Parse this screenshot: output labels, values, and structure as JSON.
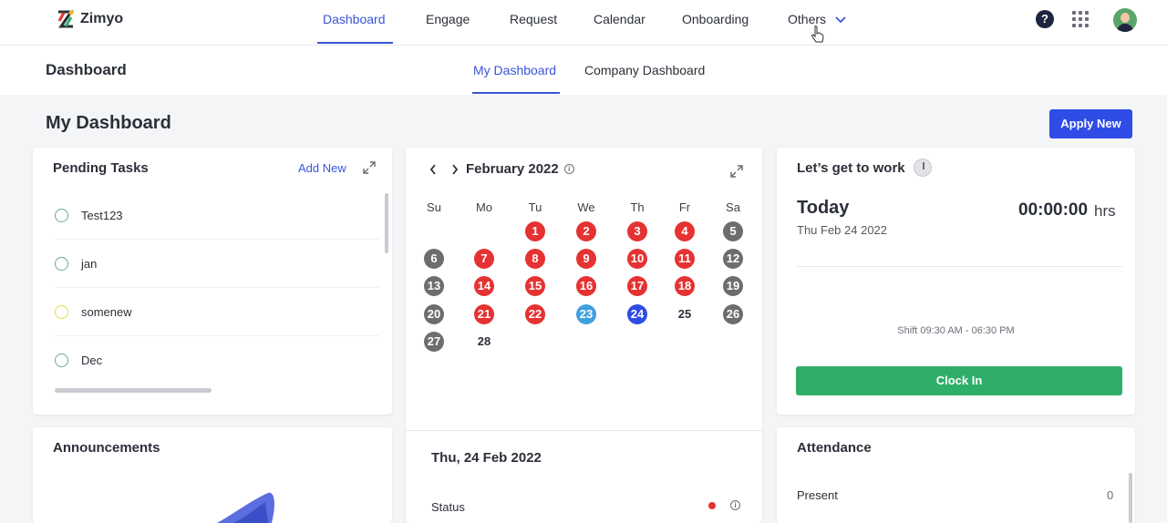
{
  "app": {
    "name": "Zimyo"
  },
  "topnav": {
    "items": [
      "Dashboard",
      "Engage",
      "Request",
      "Calendar",
      "Onboarding",
      "Others"
    ],
    "active": "Dashboard",
    "help_label": "?"
  },
  "subheader": {
    "title": "Dashboard",
    "tabs": [
      "My Dashboard",
      "Company Dashboard"
    ],
    "active_tab": "My Dashboard"
  },
  "page": {
    "title": "My Dashboard",
    "apply_button": "Apply New"
  },
  "pending_tasks": {
    "title": "Pending Tasks",
    "add_new": "Add New",
    "tasks": [
      {
        "label": "Test123",
        "color": "#6da6a0"
      },
      {
        "label": "jan",
        "color": "#6da6a0"
      },
      {
        "label": "somenew",
        "color": "#e6df3c"
      },
      {
        "label": "Dec",
        "color": "#6da6a0"
      }
    ]
  },
  "calendar": {
    "month": "February 2022",
    "info_icon": "i",
    "weekdays": [
      "Su",
      "Mo",
      "Tu",
      "We",
      "Th",
      "Fr",
      "Sa"
    ],
    "days": [
      {
        "d": "1",
        "status": "red"
      },
      {
        "d": "2",
        "status": "red"
      },
      {
        "d": "3",
        "status": "red"
      },
      {
        "d": "4",
        "status": "red"
      },
      {
        "d": "5",
        "status": "grey"
      },
      {
        "d": "6",
        "status": "grey"
      },
      {
        "d": "7",
        "status": "red"
      },
      {
        "d": "8",
        "status": "red"
      },
      {
        "d": "9",
        "status": "red"
      },
      {
        "d": "10",
        "status": "red"
      },
      {
        "d": "11",
        "status": "red"
      },
      {
        "d": "12",
        "status": "grey"
      },
      {
        "d": "13",
        "status": "grey"
      },
      {
        "d": "14",
        "status": "red"
      },
      {
        "d": "15",
        "status": "red"
      },
      {
        "d": "16",
        "status": "red"
      },
      {
        "d": "17",
        "status": "red"
      },
      {
        "d": "18",
        "status": "red"
      },
      {
        "d": "19",
        "status": "grey"
      },
      {
        "d": "20",
        "status": "grey"
      },
      {
        "d": "21",
        "status": "red"
      },
      {
        "d": "22",
        "status": "red"
      },
      {
        "d": "23",
        "status": "lightblue"
      },
      {
        "d": "24",
        "status": "blue"
      },
      {
        "d": "25",
        "status": "plain"
      },
      {
        "d": "26",
        "status": "grey"
      },
      {
        "d": "27",
        "status": "grey"
      },
      {
        "d": "28",
        "status": "plain"
      }
    ],
    "selected_date": "Thu, 24 Feb 2022",
    "status_label": "Status",
    "status_color": "#e53232"
  },
  "work": {
    "title": "Let’s get to work",
    "today_label": "Today",
    "today_date": "Thu Feb 24 2022",
    "timer": "00:00:00",
    "timer_unit": "hrs",
    "shift": "Shift 09:30 AM - 06:30 PM",
    "clock_in": "Clock In"
  },
  "announcements": {
    "title": "Announcements"
  },
  "attendance": {
    "title": "Attendance",
    "rows": [
      {
        "label": "Present",
        "value": "0"
      }
    ]
  },
  "colors": {
    "accent": "#3a55d6",
    "button_blue": "#2f4ce6",
    "clock_in_green": "#2fae6a",
    "absent_red": "#e53232",
    "weekend_grey": "#6d6d6d"
  }
}
